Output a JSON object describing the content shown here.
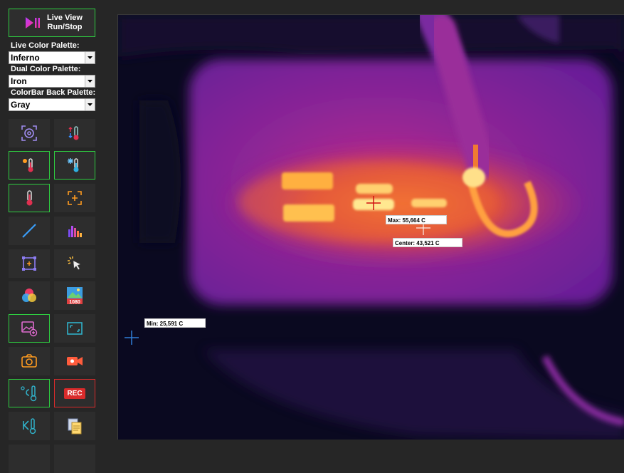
{
  "live_button": {
    "line1": "Live View",
    "line2": "Run/Stop"
  },
  "palettes": {
    "live_label": "Live Color Palette:",
    "live_value": "Inferno",
    "dual_label": "Dual Color Palette:",
    "dual_value": "Iron",
    "colorbar_label": "ColorBar Back Palette:",
    "colorbar_value": "Gray"
  },
  "tools": {
    "rec_label": "REC",
    "resolution_badge": "1080"
  },
  "thermal": {
    "max_label": "Max: 55,664 C",
    "center_label": "Center: 43,521 C",
    "min_label": "Min: 25,591 C"
  },
  "colors": {
    "active_border": "#2ecc40",
    "record_border": "#d92b2b",
    "max_marker": "#d01010",
    "min_marker": "#2f7fd8",
    "center_marker": "#ffffff"
  }
}
